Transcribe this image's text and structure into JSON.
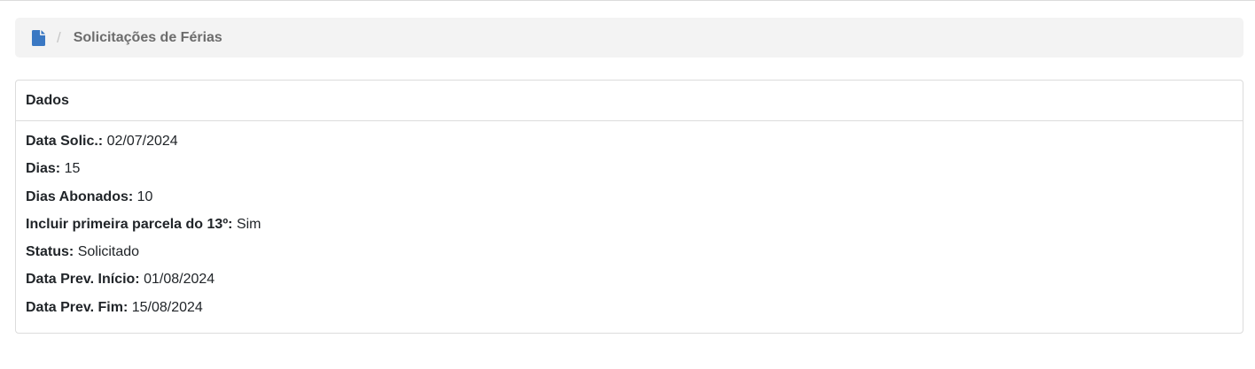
{
  "breadcrumb": {
    "icon": "document-icon",
    "separator": "/",
    "current": "Solicitações de Férias"
  },
  "card": {
    "title": "Dados",
    "fields": [
      {
        "label": "Data Solic.:",
        "value": "02/07/2024"
      },
      {
        "label": "Dias:",
        "value": "15"
      },
      {
        "label": "Dias Abonados:",
        "value": "10"
      },
      {
        "label": "Incluir primeira parcela do 13º:",
        "value": "Sim"
      },
      {
        "label": "Status:",
        "value": "Solicitado"
      },
      {
        "label": "Data Prev. Início:",
        "value": "01/08/2024"
      },
      {
        "label": "Data Prev. Fim:",
        "value": "15/08/2024"
      }
    ]
  },
  "colors": {
    "icon": "#3a78c3",
    "breadcrumb_bg": "#f3f3f3",
    "border": "#dcdcdc"
  }
}
